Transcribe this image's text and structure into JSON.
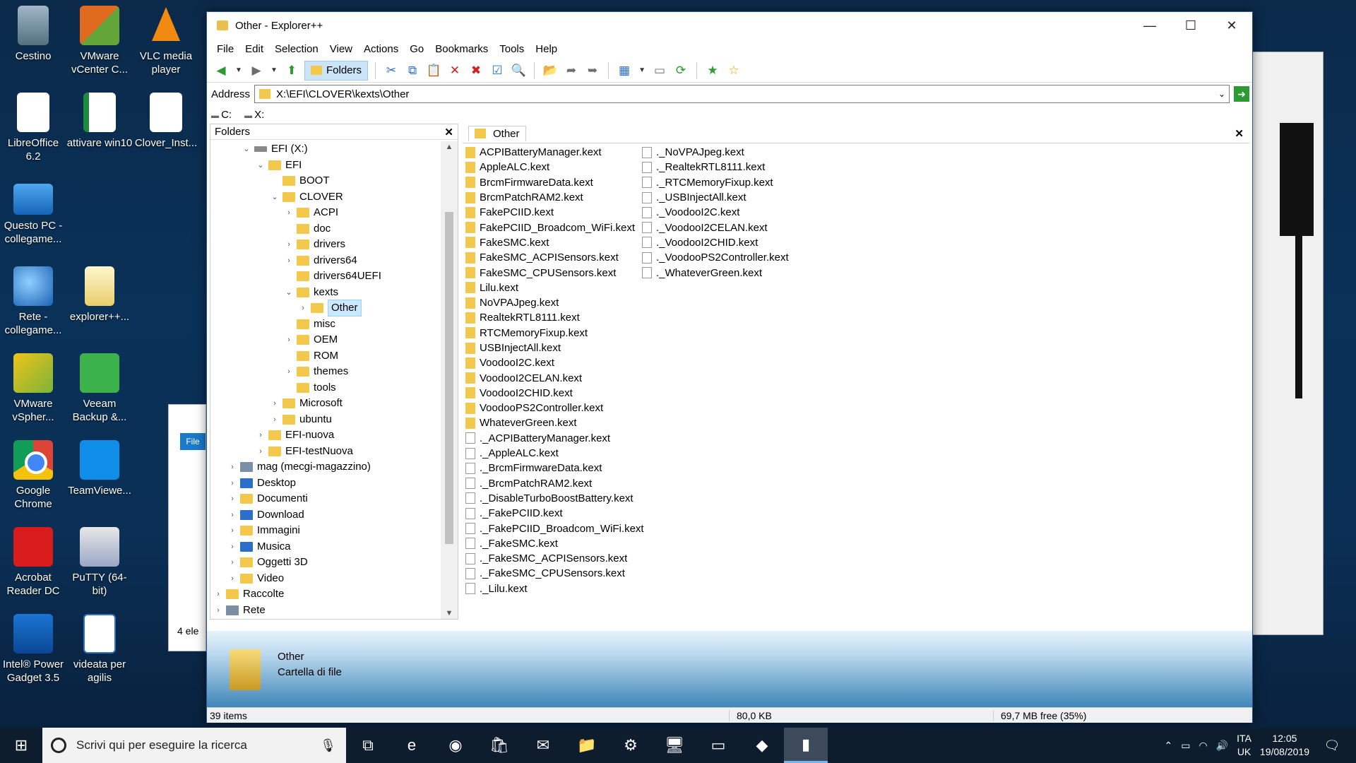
{
  "desktop": {
    "icons": [
      {
        "label": "Cestino",
        "name": "recycle-bin-icon",
        "cls": "ic-bin"
      },
      {
        "label": "VMware vCenter C...",
        "name": "vmware-vcenter-icon",
        "cls": "ic-vmw"
      },
      {
        "label": "VLC media player",
        "name": "vlc-icon",
        "cls": "ic-vlc"
      },
      {
        "label": "LibreOffice 6.2",
        "name": "libreoffice-icon",
        "cls": "ic-doc"
      },
      {
        "label": "attivare win10",
        "name": "spreadsheet-file-icon",
        "cls": "ic-xls"
      },
      {
        "label": "Clover_Inst...",
        "name": "document-file-icon",
        "cls": "ic-doc"
      },
      {
        "label": "Questo PC - collegame...",
        "name": "this-pc-icon",
        "cls": "ic-pc"
      },
      {
        "label": "Rete - collegame...",
        "name": "network-icon",
        "cls": "ic-net"
      },
      {
        "label": "explorer++...",
        "name": "zip-archive-icon",
        "cls": "ic-zip"
      },
      {
        "label": "VMware vSpher...",
        "name": "vmware-vsphere-icon",
        "cls": "ic-vsph"
      },
      {
        "label": "Veeam Backup &...",
        "name": "veeam-icon",
        "cls": "ic-veeam"
      },
      {
        "label": "Google Chrome",
        "name": "chrome-icon",
        "cls": "ic-chrome"
      },
      {
        "label": "TeamViewe...",
        "name": "teamviewer-icon",
        "cls": "ic-tv"
      },
      {
        "label": "Acrobat Reader DC",
        "name": "acrobat-icon",
        "cls": "ic-acro"
      },
      {
        "label": "PuTTY (64-bit)",
        "name": "putty-icon",
        "cls": "ic-putty"
      },
      {
        "label": "Intel® Power Gadget 3.5",
        "name": "intel-power-gadget-icon",
        "cls": "ic-intel"
      },
      {
        "label": "videata per agilis",
        "name": "image-file-icon",
        "cls": "ic-vid"
      }
    ]
  },
  "background_window_left": {
    "file_tab": "File",
    "status": "4 ele"
  },
  "window": {
    "title": "Other - Explorer++",
    "minimize": "—",
    "maximize": "☐",
    "close": "✕"
  },
  "menu": [
    "File",
    "Edit",
    "Selection",
    "View",
    "Actions",
    "Go",
    "Bookmarks",
    "Tools",
    "Help"
  ],
  "toolbar": {
    "folders_label": "Folders"
  },
  "address": {
    "label": "Address",
    "path": "X:\\EFI\\CLOVER\\kexts\\Other"
  },
  "drives": [
    "C:",
    "X:"
  ],
  "folder_pane": {
    "title": "Folders",
    "close": "✕",
    "tree": [
      {
        "label": "EFI (X:)",
        "level": 0,
        "arrow": "⌄",
        "kind": "drive"
      },
      {
        "label": "EFI",
        "level": 1,
        "arrow": "⌄",
        "kind": "folder"
      },
      {
        "label": "BOOT",
        "level": 2,
        "arrow": "",
        "kind": "folder"
      },
      {
        "label": "CLOVER",
        "level": 2,
        "arrow": "⌄",
        "kind": "folder"
      },
      {
        "label": "ACPI",
        "level": 3,
        "arrow": "›",
        "kind": "folder"
      },
      {
        "label": "doc",
        "level": 3,
        "arrow": "",
        "kind": "folder"
      },
      {
        "label": "drivers",
        "level": 3,
        "arrow": "›",
        "kind": "folder"
      },
      {
        "label": "drivers64",
        "level": 3,
        "arrow": "›",
        "kind": "folder"
      },
      {
        "label": "drivers64UEFI",
        "level": 3,
        "arrow": "",
        "kind": "folder"
      },
      {
        "label": "kexts",
        "level": 3,
        "arrow": "⌄",
        "kind": "folder"
      },
      {
        "label": "Other",
        "level": 4,
        "arrow": "›",
        "kind": "folder",
        "selected": true
      },
      {
        "label": "misc",
        "level": 3,
        "arrow": "",
        "kind": "folder"
      },
      {
        "label": "OEM",
        "level": 3,
        "arrow": "›",
        "kind": "folder"
      },
      {
        "label": "ROM",
        "level": 3,
        "arrow": "",
        "kind": "folder"
      },
      {
        "label": "themes",
        "level": 3,
        "arrow": "›",
        "kind": "folder"
      },
      {
        "label": "tools",
        "level": 3,
        "arrow": "",
        "kind": "folder"
      },
      {
        "label": "Microsoft",
        "level": 2,
        "arrow": "›",
        "kind": "folder"
      },
      {
        "label": "ubuntu",
        "level": 2,
        "arrow": "›",
        "kind": "folder"
      },
      {
        "label": "EFI-nuova",
        "level": 1,
        "arrow": "›",
        "kind": "folder"
      },
      {
        "label": "EFI-testNuova",
        "level": 1,
        "arrow": "›",
        "kind": "folder"
      },
      {
        "label": "mag (mecgi-magazzino)",
        "level": -1,
        "arrow": "›",
        "kind": "net"
      },
      {
        "label": "Desktop",
        "level": -1,
        "arrow": "›",
        "kind": "blue"
      },
      {
        "label": "Documenti",
        "level": -1,
        "arrow": "›",
        "kind": "folder"
      },
      {
        "label": "Download",
        "level": -1,
        "arrow": "›",
        "kind": "blue"
      },
      {
        "label": "Immagini",
        "level": -1,
        "arrow": "›",
        "kind": "folder"
      },
      {
        "label": "Musica",
        "level": -1,
        "arrow": "›",
        "kind": "blue"
      },
      {
        "label": "Oggetti 3D",
        "level": -1,
        "arrow": "›",
        "kind": "folder"
      },
      {
        "label": "Video",
        "level": -1,
        "arrow": "›",
        "kind": "folder"
      },
      {
        "label": "Raccolte",
        "level": -2,
        "arrow": "›",
        "kind": "folder"
      },
      {
        "label": "Rete",
        "level": -2,
        "arrow": "›",
        "kind": "net"
      }
    ]
  },
  "tab": {
    "label": "Other",
    "close": "✕"
  },
  "files": {
    "column1": [
      {
        "name": "ACPIBatteryManager.kext",
        "kind": "folder"
      },
      {
        "name": "AppleALC.kext",
        "kind": "folder"
      },
      {
        "name": "BrcmFirmwareData.kext",
        "kind": "folder"
      },
      {
        "name": "BrcmPatchRAM2.kext",
        "kind": "folder"
      },
      {
        "name": "FakePCIID.kext",
        "kind": "folder"
      },
      {
        "name": "FakePCIID_Broadcom_WiFi.kext",
        "kind": "folder"
      },
      {
        "name": "FakeSMC.kext",
        "kind": "folder"
      },
      {
        "name": "FakeSMC_ACPISensors.kext",
        "kind": "folder"
      },
      {
        "name": "FakeSMC_CPUSensors.kext",
        "kind": "folder"
      },
      {
        "name": "Lilu.kext",
        "kind": "folder"
      },
      {
        "name": "NoVPAJpeg.kext",
        "kind": "folder"
      },
      {
        "name": "RealtekRTL8111.kext",
        "kind": "folder"
      },
      {
        "name": "RTCMemoryFixup.kext",
        "kind": "folder"
      },
      {
        "name": "USBInjectAll.kext",
        "kind": "folder"
      },
      {
        "name": "VoodooI2C.kext",
        "kind": "folder"
      },
      {
        "name": "VoodooI2CELAN.kext",
        "kind": "folder"
      },
      {
        "name": "VoodooI2CHID.kext",
        "kind": "folder"
      },
      {
        "name": "VoodooPS2Controller.kext",
        "kind": "folder"
      },
      {
        "name": "WhateverGreen.kext",
        "kind": "folder"
      },
      {
        "name": "._ACPIBatteryManager.kext",
        "kind": "file"
      },
      {
        "name": "._AppleALC.kext",
        "kind": "file"
      },
      {
        "name": "._BrcmFirmwareData.kext",
        "kind": "file"
      },
      {
        "name": "._BrcmPatchRAM2.kext",
        "kind": "file"
      },
      {
        "name": "._DisableTurboBoostBattery.kext",
        "kind": "file"
      },
      {
        "name": "._FakePCIID.kext",
        "kind": "file"
      },
      {
        "name": "._FakePCIID_Broadcom_WiFi.kext",
        "kind": "file"
      },
      {
        "name": "._FakeSMC.kext",
        "kind": "file"
      },
      {
        "name": "._FakeSMC_ACPISensors.kext",
        "kind": "file"
      },
      {
        "name": "._FakeSMC_CPUSensors.kext",
        "kind": "file"
      },
      {
        "name": "._Lilu.kext",
        "kind": "file"
      }
    ],
    "column2": [
      {
        "name": "._NoVPAJpeg.kext",
        "kind": "file"
      },
      {
        "name": "._RealtekRTL8111.kext",
        "kind": "file"
      },
      {
        "name": "._RTCMemoryFixup.kext",
        "kind": "file"
      },
      {
        "name": "._USBInjectAll.kext",
        "kind": "file"
      },
      {
        "name": "._VoodooI2C.kext",
        "kind": "file"
      },
      {
        "name": "._VoodooI2CELAN.kext",
        "kind": "file"
      },
      {
        "name": "._VoodooI2CHID.kext",
        "kind": "file"
      },
      {
        "name": "._VoodooPS2Controller.kext",
        "kind": "file"
      },
      {
        "name": "._WhateverGreen.kext",
        "kind": "file"
      }
    ]
  },
  "info": {
    "name": "Other",
    "type": "Cartella di file"
  },
  "status": {
    "items": "39 items",
    "size": "80,0 KB",
    "free": "69,7 MB free (35%)"
  },
  "taskbar": {
    "search_placeholder": "Scrivi qui per eseguire la ricerca",
    "apps": [
      {
        "name": "task-view-icon",
        "glyph": "⧉"
      },
      {
        "name": "edge-icon",
        "glyph": "e"
      },
      {
        "name": "chrome-taskbar-icon",
        "glyph": "◉"
      },
      {
        "name": "store-icon",
        "glyph": "🛍"
      },
      {
        "name": "mail-icon",
        "glyph": "✉"
      },
      {
        "name": "file-explorer-icon",
        "glyph": "📁"
      },
      {
        "name": "settings-icon",
        "glyph": "⚙"
      },
      {
        "name": "remote-desktop-icon",
        "glyph": "🖥"
      },
      {
        "name": "terminal-icon",
        "glyph": "▭"
      },
      {
        "name": "app-icon",
        "glyph": "◆"
      },
      {
        "name": "explorerpp-taskbar-icon",
        "glyph": "▮",
        "active": true
      }
    ],
    "lang_top": "ITA",
    "lang_bottom": "UK",
    "time": "12:05",
    "date": "19/08/2019"
  }
}
